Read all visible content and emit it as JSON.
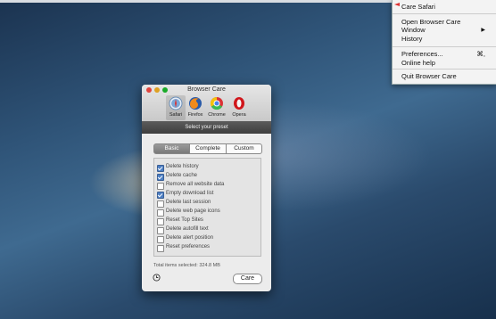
{
  "menu": {
    "items": [
      {
        "label": "Care Safari"
      },
      {
        "label": "Open Browser Care"
      },
      {
        "label": "Window"
      },
      {
        "label": "History"
      },
      {
        "label": "Preferences..."
      },
      {
        "label": "Online help"
      },
      {
        "label": "Quit Browser Care"
      }
    ],
    "preferences_shortcut": "⌘,"
  },
  "window": {
    "title": "Browser Care",
    "browsers": [
      {
        "label": "Safari",
        "icon": "safari-icon",
        "selected": true
      },
      {
        "label": "Firefox",
        "icon": "firefox-icon"
      },
      {
        "label": "Chrome",
        "icon": "chrome-icon"
      },
      {
        "label": "Opera",
        "icon": "opera-icon"
      }
    ],
    "preset_header": "Select your preset",
    "tabs": [
      "Basic",
      "Complete",
      "Custom"
    ],
    "active_tab": "Basic",
    "options": [
      {
        "label": "Delete history",
        "checked": true
      },
      {
        "label": "Delete cache",
        "checked": true
      },
      {
        "label": "Remove all website data",
        "checked": false
      },
      {
        "label": "Empty download list",
        "checked": true
      },
      {
        "label": "Delete last session",
        "checked": false
      },
      {
        "label": "Delete web page icons",
        "checked": false
      },
      {
        "label": "Reset Top Sites",
        "checked": false
      },
      {
        "label": "Delete autofill text",
        "checked": false
      },
      {
        "label": "Delete alert position",
        "checked": false
      },
      {
        "label": "Reset preferences",
        "checked": false
      }
    ],
    "total_label": "Total items selected: 324.8 MB",
    "care_button": "Care"
  }
}
